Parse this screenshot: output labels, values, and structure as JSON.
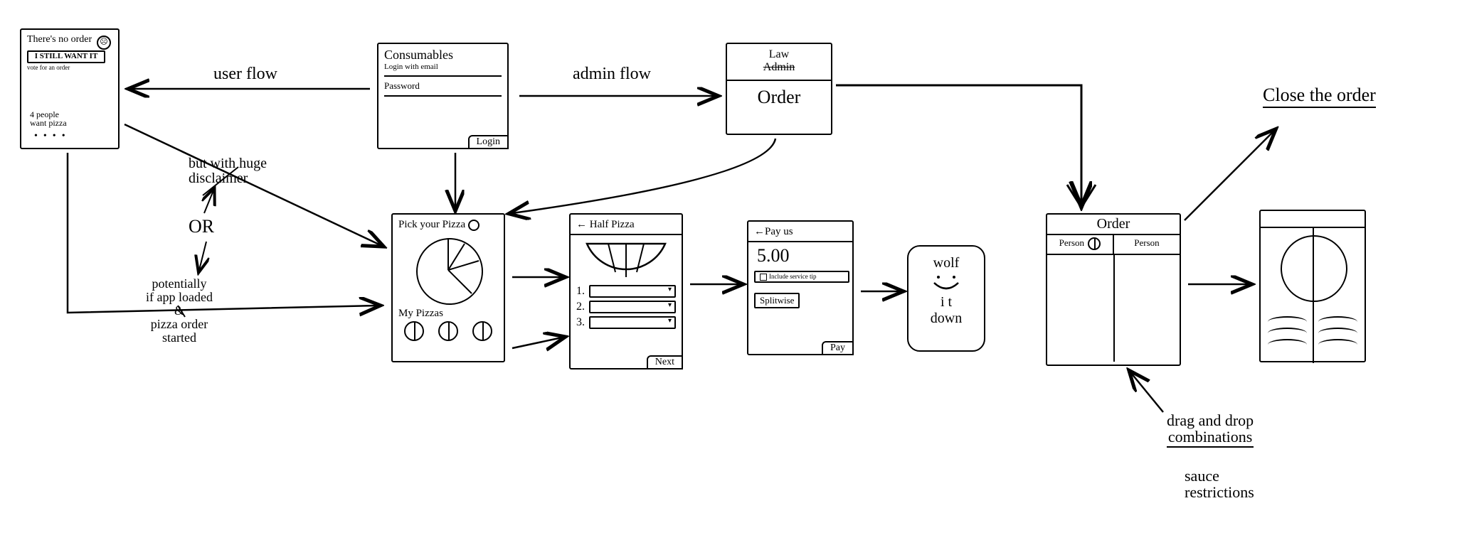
{
  "flowLabels": {
    "userFlow": "user flow",
    "adminFlow": "admin flow"
  },
  "annotations": {
    "disclaimer": "but with huge\ndisclaimer",
    "or": "OR",
    "appLoaded": "potentially\nif app loaded\n&\npizza order\nstarted",
    "closeOrder": "Close the order",
    "dragDrop": "drag and drop\ncombinations",
    "sauce": "sauce\nrestrictions"
  },
  "screens": {
    "noOrder": {
      "title": "There's no\norder",
      "button": "I STILL WANT\nIT",
      "sub": "vote for an order",
      "footer": "4 people\nwant pizza"
    },
    "login": {
      "title": "Consumables",
      "sub": "Login with email",
      "passwordLabel": "Password",
      "button": "Login"
    },
    "author": {
      "lineTop": "Law",
      "lineStruck": "Admin",
      "main": "Order"
    },
    "pick": {
      "title": "Pick your Pizza",
      "footer": "My Pizzas"
    },
    "half": {
      "back": "←",
      "title": "Half Pizza",
      "row1": "1.",
      "row2": "2.",
      "row3": "3.",
      "button": "Next"
    },
    "pay": {
      "back": "←",
      "title": "Pay us",
      "amount": "5.00",
      "checkboxLabel": "Include service tip",
      "splitwise": "Splitwise",
      "button": "Pay"
    },
    "wolf": {
      "l1": "wolf",
      "l2": "i t",
      "l3": "down"
    },
    "orderSplit": {
      "title": "Order",
      "left": "Person",
      "right": "Person"
    }
  }
}
